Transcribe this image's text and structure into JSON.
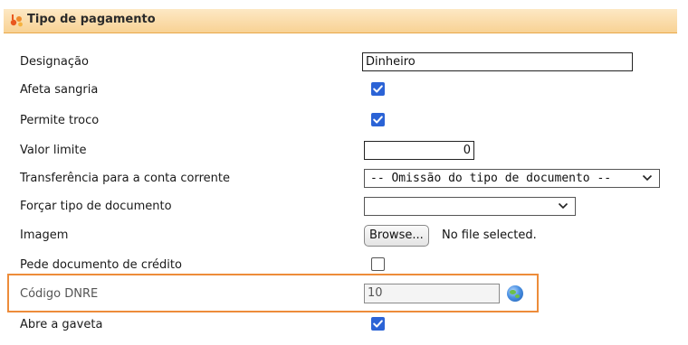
{
  "header": {
    "title": "Tipo de pagamento",
    "icon": "payment-type-icon"
  },
  "fields": {
    "designacao": {
      "label": "Designação",
      "value": "Dinheiro"
    },
    "afeta_sangria": {
      "label": "Afeta sangria",
      "checked": true
    },
    "permite_troco": {
      "label": "Permite troco",
      "checked": true
    },
    "valor_limite": {
      "label": "Valor limite",
      "value": "0"
    },
    "transferencia": {
      "label": "Transferência para a conta corrente",
      "selected": "-- Omissão do tipo de documento --"
    },
    "forcar_tipo": {
      "label": "Forçar tipo de documento",
      "selected": ""
    },
    "imagem": {
      "label": "Imagem",
      "button": "Browse...",
      "status": "No file selected."
    },
    "pede_documento": {
      "label": "Pede documento de crédito",
      "checked": false
    },
    "codigo_dnre": {
      "label": "Código DNRE",
      "value": "10"
    },
    "abre_gaveta": {
      "label": "Abre a gaveta",
      "checked": true
    }
  },
  "colors": {
    "accent": "#ed8c3a",
    "checkbox": "#2b63d6",
    "header_bg": "#f8d294"
  }
}
